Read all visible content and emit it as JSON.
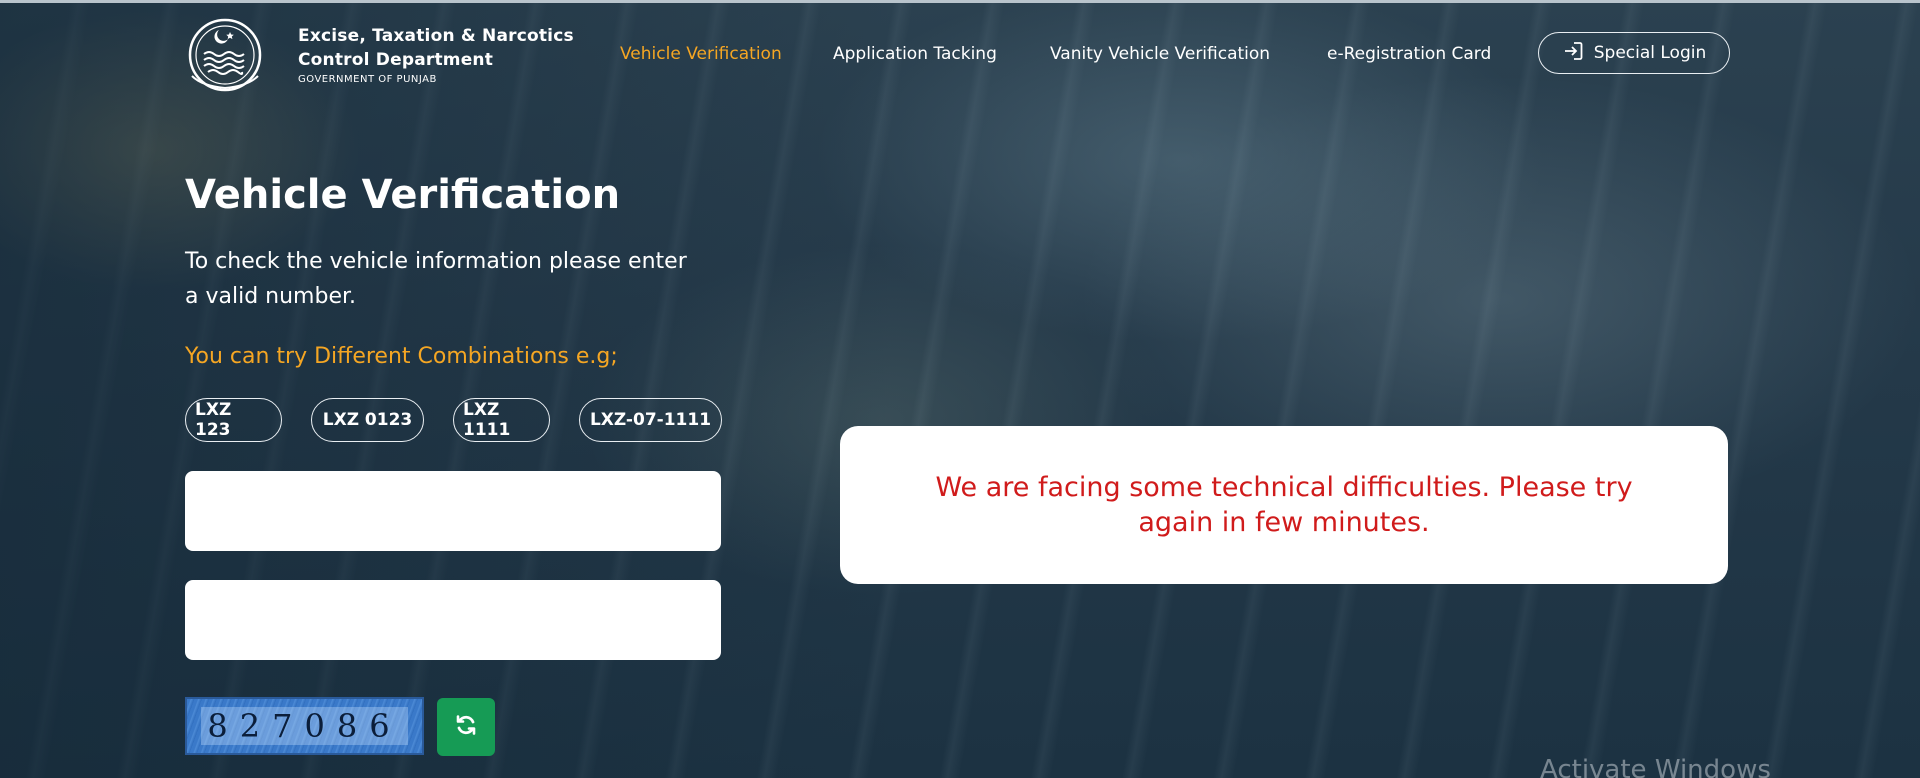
{
  "header": {
    "logo_icon": "punjab-emblem-icon",
    "brand_line1": "Excise, Taxation & Narcotics",
    "brand_line2": "Control Department",
    "brand_line3": "GOVERNMENT OF PUNJAB",
    "nav": [
      {
        "label": "Vehicle Verification",
        "active": true
      },
      {
        "label": "Application Tacking",
        "active": false
      },
      {
        "label": "Vanity Vehicle Verification",
        "active": false
      },
      {
        "label": "e-Registration Card",
        "active": false
      }
    ],
    "login_label": "Special Login",
    "login_icon": "sign-in-icon"
  },
  "main": {
    "title": "Vehicle Verification",
    "description": "To check the vehicle information please enter a valid number.",
    "hint": "You can try Different Combinations e.g;",
    "examples": [
      "LXZ 123",
      "LXZ 0123",
      "LXZ 1111",
      "LXZ-07-1111"
    ],
    "input1_value": "",
    "input2_value": "",
    "captcha_text": "827086",
    "refresh_icon": "refresh-icon"
  },
  "error": {
    "message": "We are facing some technical difficulties. Please try again in few minutes."
  },
  "overlay": {
    "watermark": "Activate Windows"
  },
  "colors": {
    "accent": "#f5a623",
    "error": "#d01b1b",
    "refresh_bg": "#169b55"
  }
}
